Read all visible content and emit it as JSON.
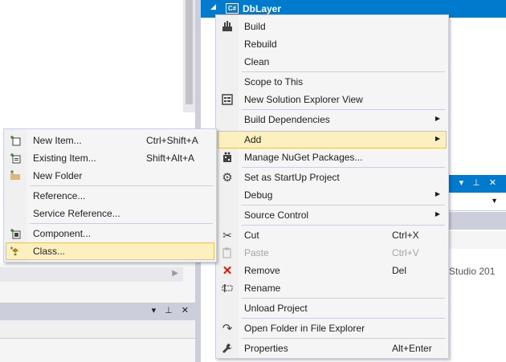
{
  "solution_explorer": {
    "project_name": "DbLayer",
    "project_badge": "C#"
  },
  "background": {
    "partial_text": "l Studio 201"
  },
  "main_menu": {
    "items": [
      {
        "label": "Build",
        "icon": "build-icon"
      },
      {
        "label": "Rebuild"
      },
      {
        "label": "Clean"
      },
      {
        "label": "Scope to This"
      },
      {
        "label": "New Solution Explorer View",
        "icon": "new-view-icon"
      },
      {
        "label": "Build Dependencies",
        "submenu": true
      },
      {
        "label": "Add",
        "submenu": true,
        "highlighted": true
      },
      {
        "label": "Manage NuGet Packages...",
        "icon": "nuget-icon"
      },
      {
        "label": "Set as StartUp Project",
        "icon": "gear-icon"
      },
      {
        "label": "Debug",
        "submenu": true
      },
      {
        "label": "Source Control",
        "submenu": true
      },
      {
        "label": "Cut",
        "shortcut": "Ctrl+X",
        "icon": "scissors-icon"
      },
      {
        "label": "Paste",
        "shortcut": "Ctrl+V",
        "icon": "paste-icon",
        "disabled": true
      },
      {
        "label": "Remove",
        "shortcut": "Del",
        "icon": "remove-icon"
      },
      {
        "label": "Rename",
        "icon": "rename-icon"
      },
      {
        "label": "Unload Project"
      },
      {
        "label": "Open Folder in File Explorer",
        "icon": "open-folder-icon"
      },
      {
        "label": "Properties",
        "shortcut": "Alt+Enter",
        "icon": "wrench-icon"
      }
    ]
  },
  "add_submenu": {
    "items": [
      {
        "label": "New Item...",
        "shortcut": "Ctrl+Shift+A",
        "icon": "new-item-icon"
      },
      {
        "label": "Existing Item...",
        "shortcut": "Shift+Alt+A",
        "icon": "existing-item-icon"
      },
      {
        "label": "New Folder",
        "icon": "folder-icon"
      },
      {
        "label": "Reference..."
      },
      {
        "label": "Service Reference..."
      },
      {
        "label": "Component...",
        "icon": "component-icon"
      },
      {
        "label": "Class...",
        "icon": "class-icon",
        "highlighted": true
      }
    ]
  },
  "colors": {
    "accent": "#007acc",
    "hover": "#fcf0c1",
    "menu_bg": "#f5f5f5",
    "remove": "#e51400"
  }
}
